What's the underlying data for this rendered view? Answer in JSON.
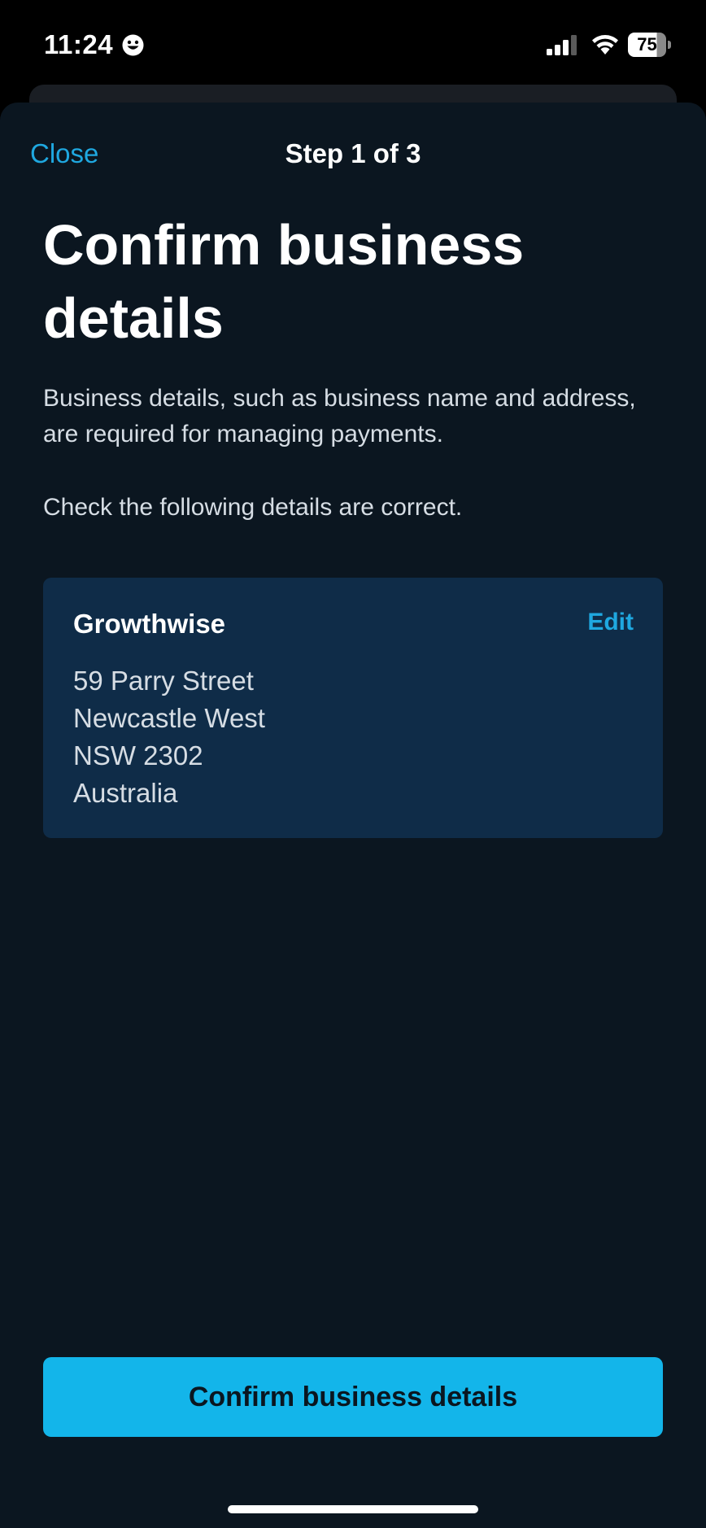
{
  "status_bar": {
    "time": "11:24",
    "battery_level": "75",
    "battery_fraction": 0.75
  },
  "icons": {
    "status_emoji": "smiley-face-icon",
    "signal": "cellular-signal-icon",
    "wifi": "wifi-icon",
    "battery": "battery-icon"
  },
  "nav": {
    "close_label": "Close",
    "step_title": "Step 1 of 3"
  },
  "content": {
    "title": "Confirm business details",
    "description": "Business details, such as business name and address, are required for managing payments.",
    "check_text": "Check the following details are correct."
  },
  "business_card": {
    "name": "Growthwise",
    "edit_label": "Edit",
    "address_lines": [
      "59 Parry Street",
      "Newcastle West",
      "NSW 2302",
      "Australia"
    ]
  },
  "actions": {
    "confirm_label": "Confirm business details"
  },
  "colors": {
    "sheet_background": "#0b1620",
    "card_background": "#0f2c48",
    "accent": "#1fa8e0",
    "primary_button": "#13b5ea"
  }
}
